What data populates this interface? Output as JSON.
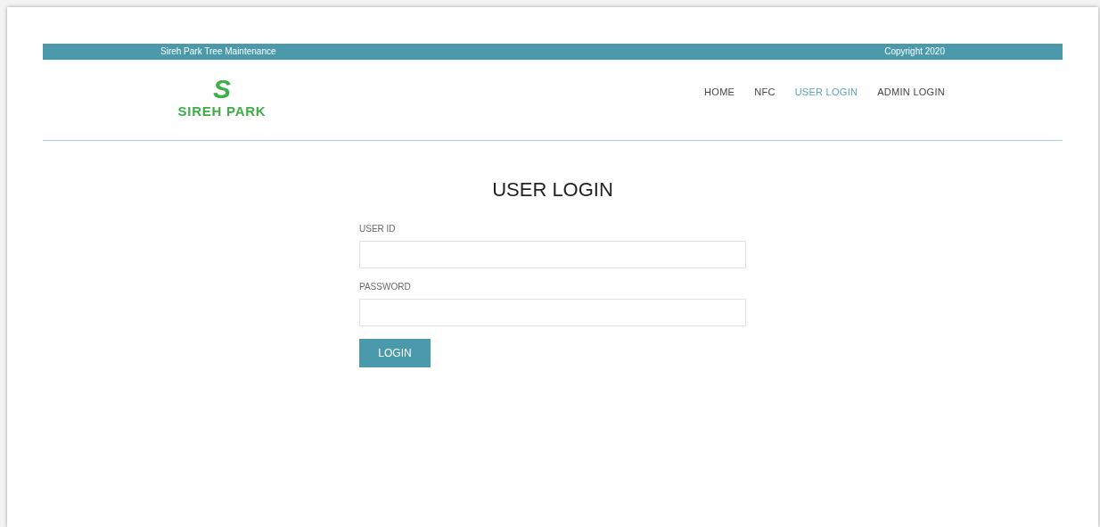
{
  "top_bar": {
    "site_name": "Sireh Park Tree Maintenance",
    "copyright": "Copyright 2020"
  },
  "logo": {
    "mark": "S",
    "name": "SIREH PARK"
  },
  "nav": [
    {
      "label": "HOME",
      "selected": false
    },
    {
      "label": "NFC",
      "selected": false
    },
    {
      "label": "USER LOGIN",
      "selected": true
    },
    {
      "label": "ADMIN LOGIN",
      "selected": false
    }
  ],
  "heading": "USER LOGIN",
  "fields": [
    {
      "label": "USER ID"
    },
    {
      "label": "PASSWORD"
    }
  ],
  "button": "LOGIN"
}
